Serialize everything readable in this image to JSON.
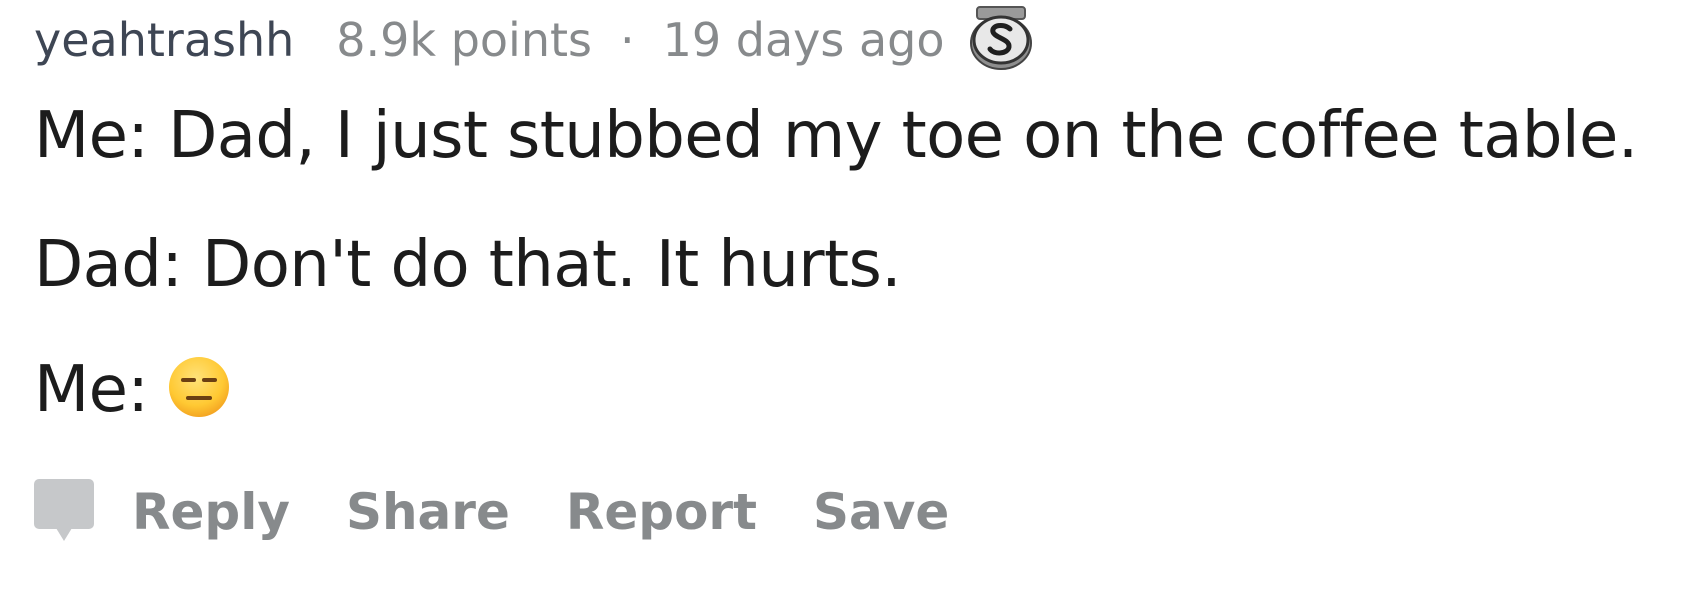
{
  "comment": {
    "username": "yeahtrashh",
    "points": "8.9k points",
    "separator": "·",
    "age": "19 days ago",
    "award_icon": "silver-award-icon",
    "body": {
      "line1": "Me: Dad, I just stubbed my toe on the coffee table.",
      "line2": "Dad: Don't do that. It hurts.",
      "line3_prefix": "Me:",
      "line3_emoji": "expressionless-face-emoji"
    }
  },
  "actions": {
    "reply_icon": "comment-bubble-icon",
    "reply": "Reply",
    "share": "Share",
    "report": "Report",
    "save": "Save"
  },
  "colors": {
    "username": "#3e4654",
    "meta": "#878a8c",
    "body_text": "#1c1c1c",
    "action_text": "#878a8c",
    "emoji_face": "#ffcc33"
  }
}
